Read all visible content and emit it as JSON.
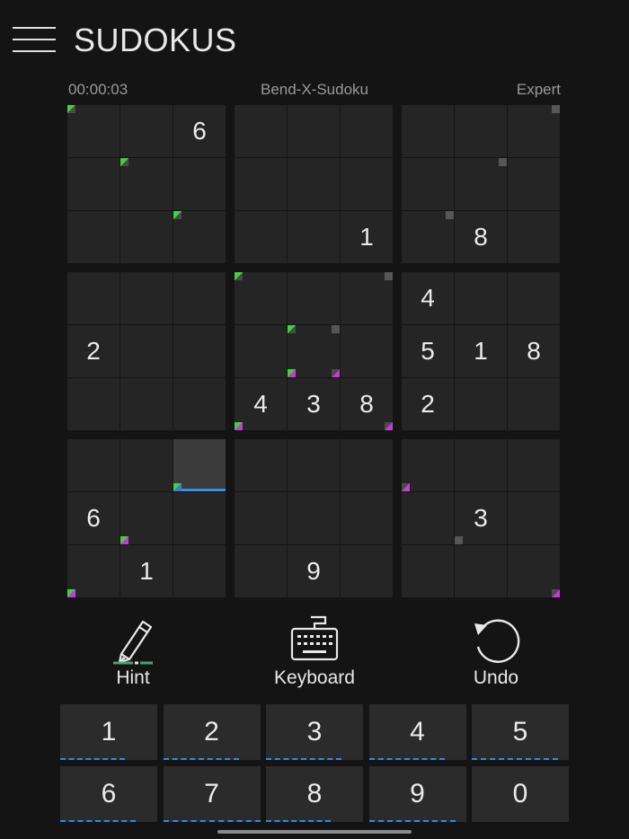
{
  "app": {
    "title": "SUDOKUS"
  },
  "game": {
    "timer": "00:00:03",
    "variant": "Bend-X-Sudoku",
    "difficulty": "Expert"
  },
  "grid": [
    [
      "",
      "",
      "6",
      "",
      "",
      "",
      "",
      "",
      ""
    ],
    [
      "",
      "",
      "",
      "",
      "",
      "",
      "",
      "",
      ""
    ],
    [
      "",
      "",
      "",
      "",
      "",
      "1",
      "",
      "8",
      ""
    ],
    [
      "",
      "",
      "",
      "",
      "",
      "",
      "4",
      "",
      ""
    ],
    [
      "2",
      "",
      "",
      "",
      "",
      "",
      "5",
      "1",
      "8"
    ],
    [
      "",
      "",
      "",
      "4",
      "3",
      "8",
      "2",
      "",
      ""
    ],
    [
      "",
      "",
      "",
      "",
      "",
      "",
      "",
      "",
      ""
    ],
    [
      "6",
      "",
      "",
      "",
      "",
      "",
      "",
      "3",
      ""
    ],
    [
      "",
      "1",
      "",
      "",
      "9",
      "",
      "",
      "",
      ""
    ]
  ],
  "selected_cell": {
    "row": 6,
    "col": 2
  },
  "colors": {
    "background": "#141414",
    "cell": "#252525",
    "diagonal_green": "#3fd43f",
    "diagonal_magenta": "#c43bd6",
    "accent_blue": "#3a8ee6"
  },
  "tools": {
    "hint": "Hint",
    "keyboard": "Keyboard",
    "undo": "Undo"
  },
  "keypad": [
    {
      "label": "1",
      "progress": 0.67
    },
    {
      "label": "2",
      "progress": 0.78
    },
    {
      "label": "3",
      "progress": 0.78
    },
    {
      "label": "4",
      "progress": 0.78
    },
    {
      "label": "5",
      "progress": 0.89
    },
    {
      "label": "6",
      "progress": 0.78
    },
    {
      "label": "7",
      "progress": 1.0
    },
    {
      "label": "8",
      "progress": 0.67
    },
    {
      "label": "9",
      "progress": 0.89
    },
    {
      "label": "0",
      "progress": 0
    }
  ]
}
